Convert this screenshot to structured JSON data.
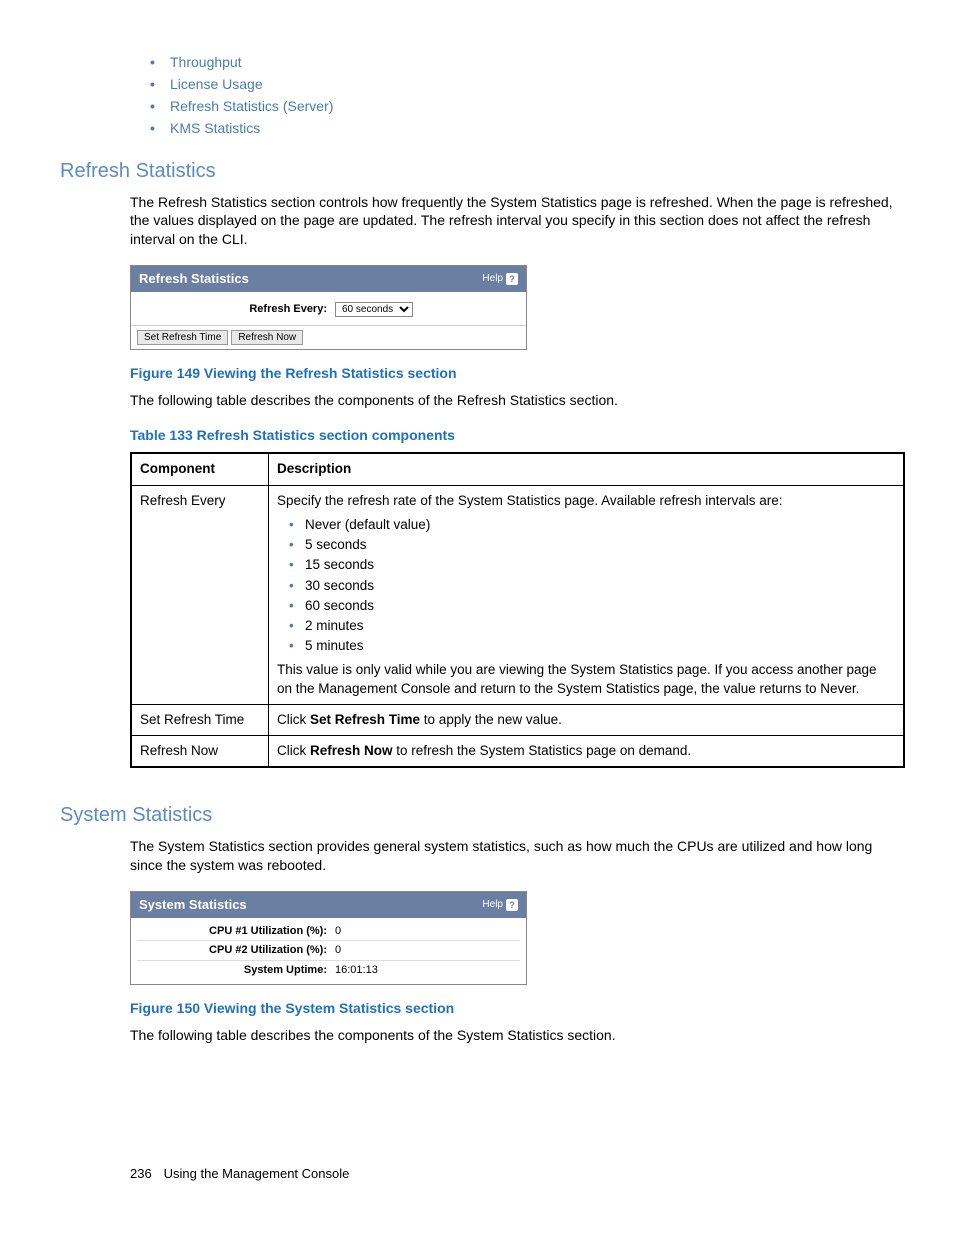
{
  "top_links": [
    "Throughput",
    "License Usage",
    "Refresh Statistics (Server)",
    "KMS Statistics"
  ],
  "sections": {
    "refresh": {
      "heading": "Refresh Statistics",
      "para": "The Refresh Statistics section controls how frequently the System Statistics page is refreshed. When the page is refreshed, the values displayed on the page are updated. The refresh interval you specify in this section does not affect the refresh interval on the CLI.",
      "panel": {
        "title": "Refresh Statistics",
        "help": "Help",
        "label": "Refresh Every:",
        "select_value": "60 seconds",
        "btn_set": "Set Refresh Time",
        "btn_now": "Refresh Now"
      },
      "fig_caption": "Figure 149 Viewing the Refresh Statistics section",
      "lead": "The following table describes the components of the Refresh Statistics section.",
      "tbl_caption": "Table 133 Refresh Statistics section components",
      "table": {
        "h1": "Component",
        "h2": "Description",
        "rows": [
          {
            "c": "Refresh Every",
            "d_pre": "Specify the refresh rate of the System Statistics page. Available refresh intervals are:",
            "items": [
              "Never (default value)",
              "5 seconds",
              "15 seconds",
              "30 seconds",
              "60 seconds",
              "2 minutes",
              "5 minutes"
            ],
            "d_post": "This value is only valid while you are viewing the System Statistics page. If you access another page on the Management Console and return to the System Statistics page, the value returns to Never."
          },
          {
            "c": "Set Refresh Time",
            "d_pre_a": "Click ",
            "d_bold": "Set Refresh Time",
            "d_pre_b": " to apply the new value."
          },
          {
            "c": "Refresh Now",
            "d_pre_a": "Click ",
            "d_bold": "Refresh Now",
            "d_pre_b": " to refresh the System Statistics page on demand."
          }
        ]
      }
    },
    "system": {
      "heading": "System Statistics",
      "para": "The System Statistics section provides general system statistics, such as how much the CPUs are utilized and how long since the system was rebooted.",
      "panel": {
        "title": "System Statistics",
        "help": "Help",
        "rows": [
          {
            "label": "CPU #1 Utilization (%):",
            "value": "0"
          },
          {
            "label": "CPU #2 Utilization (%):",
            "value": "0"
          },
          {
            "label": "System Uptime:",
            "value": "16:01:13"
          }
        ]
      },
      "fig_caption": "Figure 150 Viewing the System Statistics section",
      "lead": "The following table describes the components of the System Statistics section."
    }
  },
  "footer": {
    "page": "236",
    "title": "Using the Management Console"
  }
}
